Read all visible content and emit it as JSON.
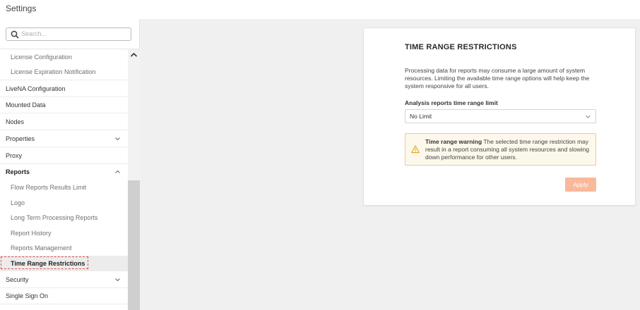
{
  "header": {
    "title": "Settings"
  },
  "sidebar": {
    "search_placeholder": "Search...",
    "items": [
      {
        "label": "License Configuration",
        "level": "sub"
      },
      {
        "label": "License Expiration Notification",
        "level": "sub"
      },
      {
        "label": "LiveNA Configuration",
        "level": "top"
      },
      {
        "label": "Mounted Data",
        "level": "top"
      },
      {
        "label": "Nodes",
        "level": "top"
      },
      {
        "label": "Properties",
        "level": "top",
        "chevron": "down"
      },
      {
        "label": "Proxy",
        "level": "top"
      },
      {
        "label": "Reports",
        "level": "top",
        "chevron": "up",
        "expanded": true
      },
      {
        "label": "Flow Reports Results Limit",
        "level": "sub"
      },
      {
        "label": "Logo",
        "level": "sub"
      },
      {
        "label": "Long Term Processing Reports",
        "level": "sub"
      },
      {
        "label": "Report History",
        "level": "sub"
      },
      {
        "label": "Reports Management",
        "level": "sub"
      },
      {
        "label": "Time Range Restrictions",
        "level": "sub",
        "selected": true
      },
      {
        "label": "Security",
        "level": "top",
        "chevron": "down"
      },
      {
        "label": "Single Sign On",
        "level": "top"
      }
    ]
  },
  "panel": {
    "title": "TIME RANGE RESTRICTIONS",
    "description": "Processing data for reports may consume a large amount of system resources. Limiting the available time range options will help keep the system responsive for all users.",
    "field_label": "Analysis reports time range limit",
    "select_value": "No Limit",
    "warning_title": "Time range warning",
    "warning_text": " The selected time range restriction may result in a report consuming all system resources and slowing down performance for other users.",
    "apply_label": "Apply"
  },
  "colors": {
    "accent_button": "#f8b99b",
    "warning_border": "#f0c890",
    "warning_bg": "#fdf8ec",
    "warning_icon": "#e8a317",
    "focus_outline": "#e05050"
  },
  "icons": {
    "search": "search-icon",
    "expand": "chevron-down-icon",
    "collapse": "chevron-up-icon",
    "scroll_up": "scroll-up-arrow-icon",
    "warning": "warning-triangle-icon"
  }
}
